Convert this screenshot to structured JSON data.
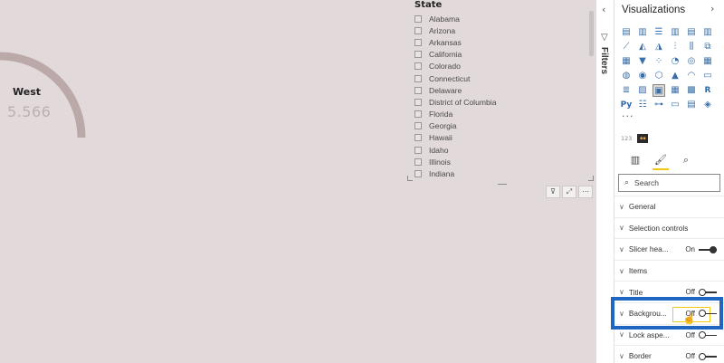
{
  "gauge": {
    "title": "West",
    "value": "5.566",
    "arc_color": "#bba9aa"
  },
  "slicer": {
    "header": "State",
    "items": [
      "Alabama",
      "Arizona",
      "Arkansas",
      "California",
      "Colorado",
      "Connecticut",
      "Delaware",
      "District of Columbia",
      "Florida",
      "Georgia",
      "Hawaii",
      "Idaho",
      "Illinois",
      "Indiana"
    ]
  },
  "visual_header_icons": [
    "filter-icon",
    "focus-mode-icon",
    "more-options-icon"
  ],
  "filters_pane": {
    "label": "Filters"
  },
  "visualizations_pane": {
    "title": "Visualizations",
    "python_label": "Py",
    "r_label": "R",
    "badge_label": "123",
    "search_placeholder": "Search",
    "sections": [
      {
        "label": "General"
      },
      {
        "label": "Selection controls"
      },
      {
        "label": "Slicer hea...",
        "toggle": "On"
      },
      {
        "label": "Items"
      },
      {
        "label": "Title",
        "toggle": "Off"
      },
      {
        "label": "Backgrou...",
        "toggle": "Off",
        "highlighted": true
      },
      {
        "label": "Lock aspe...",
        "toggle": "Off"
      },
      {
        "label": "Border",
        "toggle": "Off"
      }
    ]
  },
  "colors": {
    "canvas": "#e2d9da",
    "highlight_blue": "#1f66c2",
    "highlight_yellow": "#f2c811"
  }
}
